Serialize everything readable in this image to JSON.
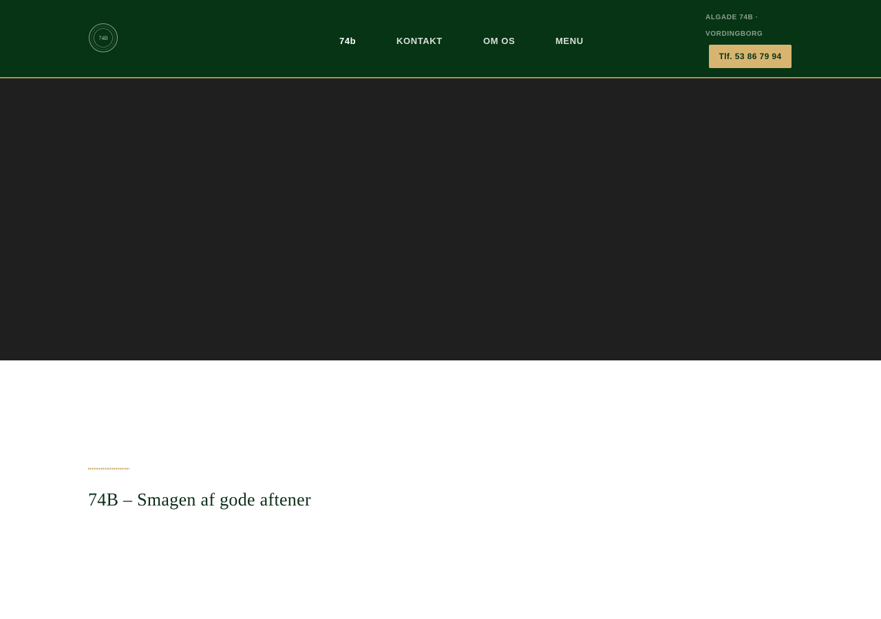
{
  "header": {
    "logo_icon": "74b-circle-logo-icon",
    "logo_text": "74B",
    "nav": [
      {
        "label": "74b",
        "active": true
      },
      {
        "label": "KONTAKT",
        "active": false
      },
      {
        "label": "OM OS",
        "active": false
      },
      {
        "label": "MENU",
        "active": false
      }
    ],
    "address_line1": "ALGADE 74B ·",
    "address_line2": "VORDINGBORG",
    "phone_label": "Tlf. 53 86 79 94"
  },
  "main": {
    "ornament_icon": "gold-dotted-divider-icon",
    "title": "74B – Smagen af gode aftener"
  },
  "colors": {
    "header_bg": "#063415",
    "accent_gold": "#d7b571",
    "hero_bg": "#1f1f1f",
    "title_color": "#0b2e17"
  }
}
